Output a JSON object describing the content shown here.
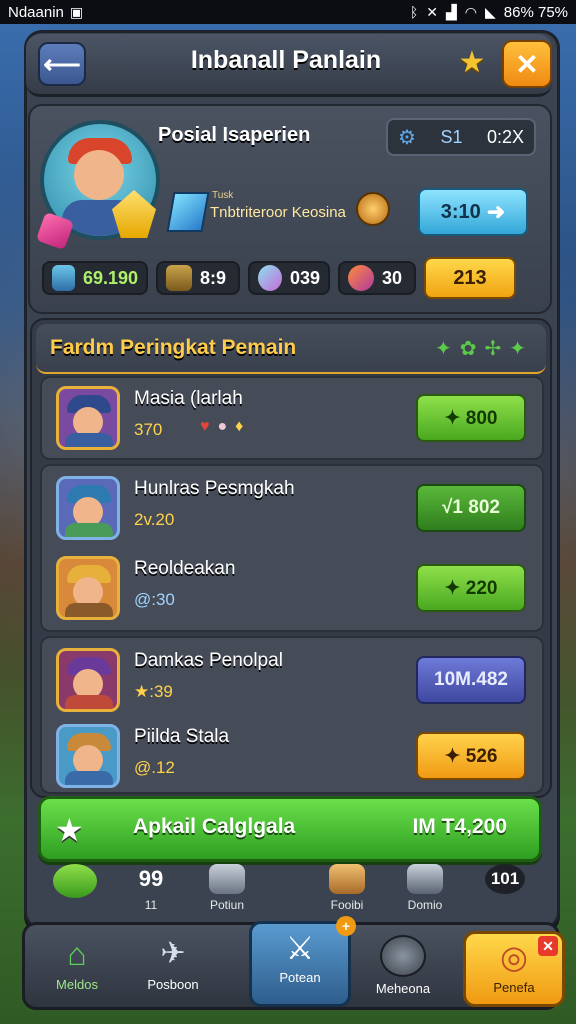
{
  "status_bar": {
    "carrier": "Ndaanin",
    "right_text": "86% 75%"
  },
  "header": {
    "title": "Inbanall Panlain"
  },
  "profile": {
    "name": "Posial Isaperien",
    "timer_level": "S1",
    "timer_value": "0:2X",
    "sub_small": "Tusk",
    "sub_main": "Tnbtriteroor Keosina",
    "next_button": "3:10",
    "resources": [
      {
        "value": "69.190"
      },
      {
        "value": "8:9"
      },
      {
        "value": "039"
      },
      {
        "value": "30"
      }
    ],
    "gold_value": "213"
  },
  "leaderboard": {
    "title": "Fardm Peringkat Pemain",
    "players": [
      {
        "name": "Masia (larlah",
        "score": "370",
        "button": "✦ 800",
        "style": "green"
      },
      {
        "name": "Hunlras Pesmgkah",
        "score": "2v.20",
        "button": "√1 802",
        "style": "dgreen"
      },
      {
        "name": "Reoldeakan",
        "score": "@:30",
        "button": "✦ 220",
        "style": "green"
      },
      {
        "name": "Damkas Penolpal",
        "score": "★:39",
        "button": "10M.482",
        "style": "purple"
      },
      {
        "name": "Piilda Stala",
        "score": "@.12",
        "button": "✦ 526",
        "style": "orange"
      }
    ]
  },
  "claim": {
    "label": "Apkail Calglgala",
    "value": "IM T4,200"
  },
  "mini_row": [
    {
      "label": "",
      "num": ""
    },
    {
      "label": "11",
      "num": "99"
    },
    {
      "label": "Potiun",
      "num": ""
    },
    {
      "label": "Fooibi",
      "num": ""
    },
    {
      "label": "Domio",
      "num": ""
    },
    {
      "label": "",
      "num": "101"
    }
  ],
  "bottom_nav": [
    {
      "label": "Meldos"
    },
    {
      "label": "Posboon"
    },
    {
      "label": "Potean"
    },
    {
      "label": "Meheona"
    },
    {
      "label": "Penefa"
    }
  ],
  "colors": {
    "gold": "#ffcb4a",
    "green": "#4aa820",
    "accent_blue": "#33a6d8"
  }
}
